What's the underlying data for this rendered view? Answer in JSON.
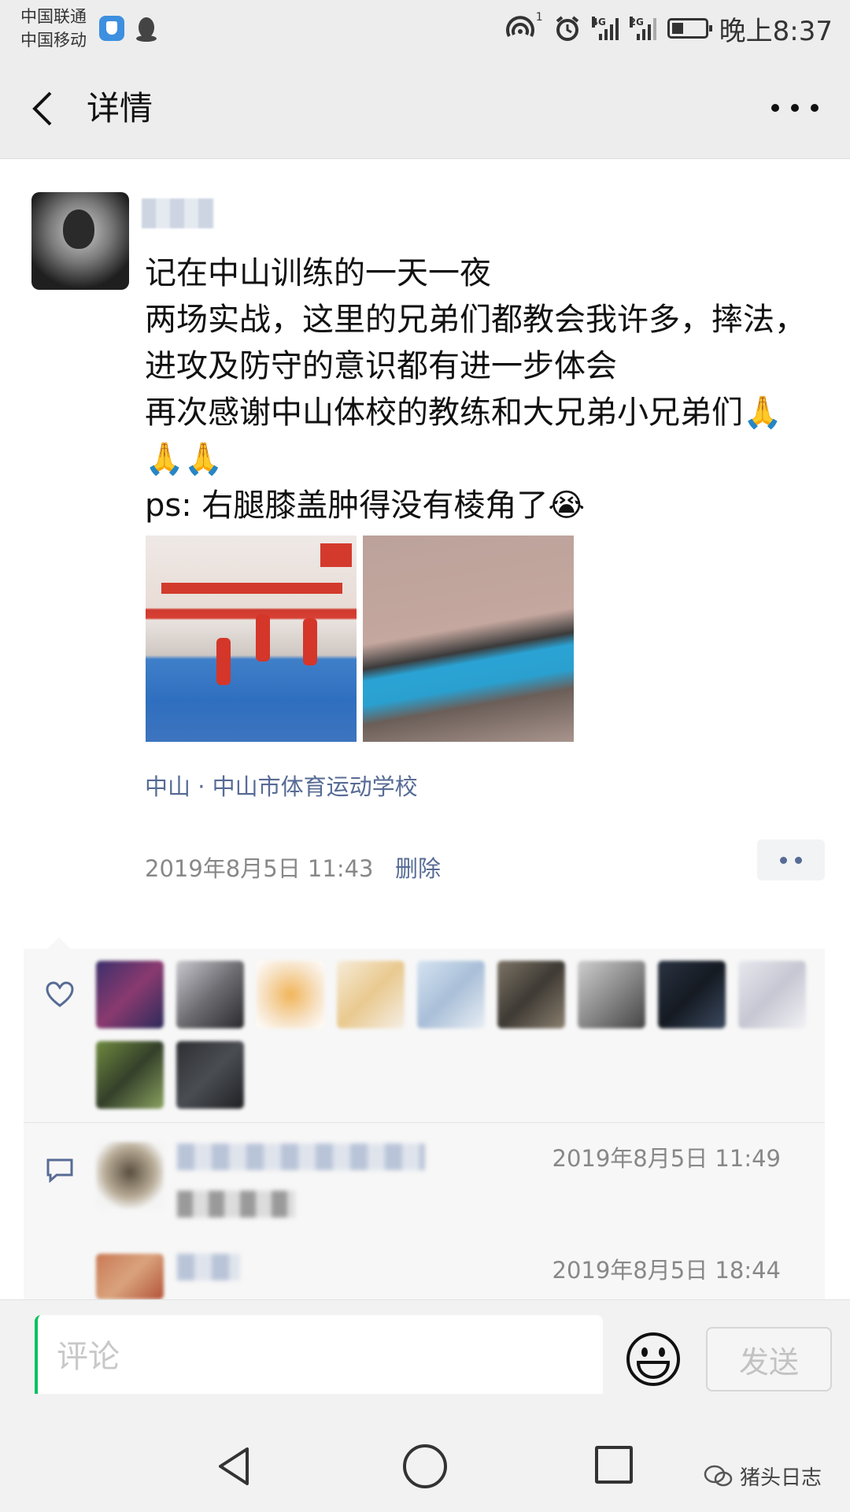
{
  "status_bar": {
    "carrier_1": "中国联通",
    "carrier_2": "中国移动",
    "hotspot_count": "1",
    "net_1": "4G",
    "net_2": "2G",
    "time": "晚上8:37"
  },
  "header": {
    "title": "详情"
  },
  "post": {
    "text": "记在中山训练的一天一夜\n两场实战，这里的兄弟们都教会我许多，摔法，进攻及防守的意识都有进一步体会\n再次感谢中山体校的教练和大兄弟小兄弟们🙏🙏🙏\nps: 右腿膝盖肿得没有棱角了😭",
    "location": "中山 · 中山市体育运动学校",
    "time": "2019年8月5日 11:43",
    "delete_label": "删除"
  },
  "comments": [
    {
      "time": "2019年8月5日 11:49"
    },
    {
      "time": "2019年8月5日 18:44"
    }
  ],
  "comment_bar": {
    "placeholder": "评论",
    "send_label": "发送"
  },
  "watermark": {
    "text": "猪头日志"
  },
  "colors": {
    "link": "#576b95",
    "accent": "#07c160",
    "panel_bg": "#f7f7f7",
    "header_bg": "#ededed"
  }
}
